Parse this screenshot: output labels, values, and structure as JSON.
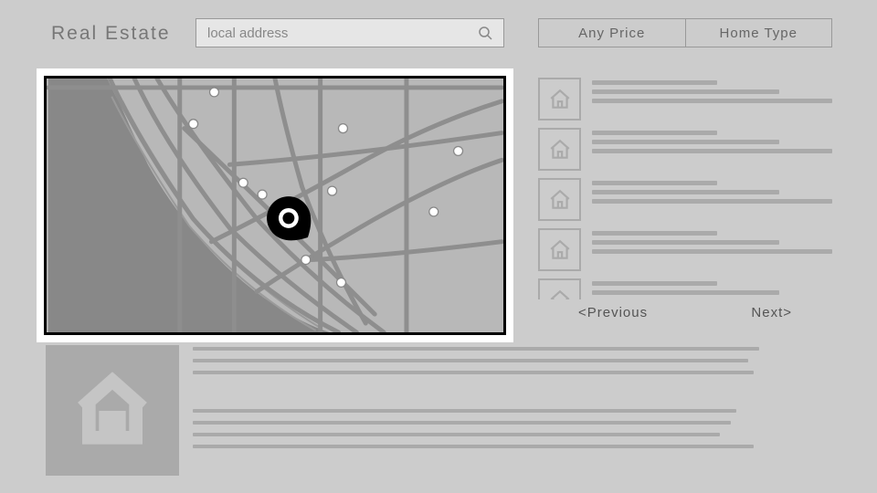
{
  "header": {
    "title": "Real Estate",
    "search_placeholder": "local address",
    "filters": {
      "price": "Any Price",
      "home_type": "Home Type"
    }
  },
  "pagination": {
    "prev": "<Previous",
    "next": "Next>"
  },
  "results": [
    {
      "id": 1
    },
    {
      "id": 2
    },
    {
      "id": 3
    },
    {
      "id": 4
    },
    {
      "id": 5
    }
  ]
}
